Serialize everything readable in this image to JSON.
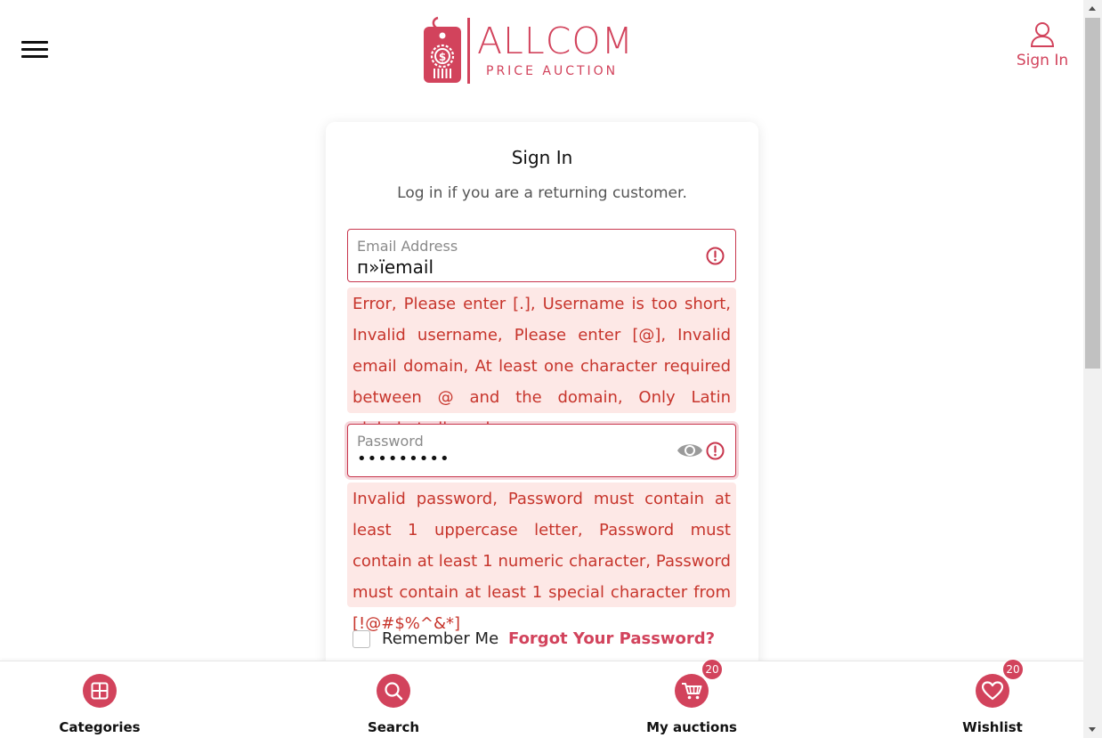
{
  "header": {
    "logo_main": "ALLCOM",
    "logo_sub": "PRICE AUCTION",
    "sign_in_label": "Sign In"
  },
  "signin_form": {
    "title": "Sign In",
    "subtitle": "Log in if you are a returning customer.",
    "email": {
      "label": "Email Address",
      "value": "п»їemail",
      "error": "Error, Please enter [.], Username is too short, Invalid username, Please enter [@], Invalid email domain, At least one character required between @ and the domain, Only Latin alphabet allowed"
    },
    "password": {
      "label": "Password",
      "value": "•••••••••",
      "error": "Invalid password, Password must contain at least 1 uppercase letter, Password must contain at least 1 numeric character, Password must contain at least 1 special character from [!@#$%^&*]"
    },
    "remember_me": "Remember Me",
    "remember_checked": false,
    "forgot_password": "Forgot Your Password?"
  },
  "bottom_nav": {
    "items": [
      {
        "label": "Categories",
        "icon": "grid-icon"
      },
      {
        "label": "Search",
        "icon": "search-icon"
      },
      {
        "label": "My auctions",
        "icon": "cart-icon",
        "badge": "20"
      },
      {
        "label": "Wishlist",
        "icon": "heart-icon",
        "badge": "20"
      }
    ]
  },
  "colors": {
    "brand": "#d2435c",
    "error_text": "#c7352c",
    "error_bg": "#fde8e6"
  }
}
